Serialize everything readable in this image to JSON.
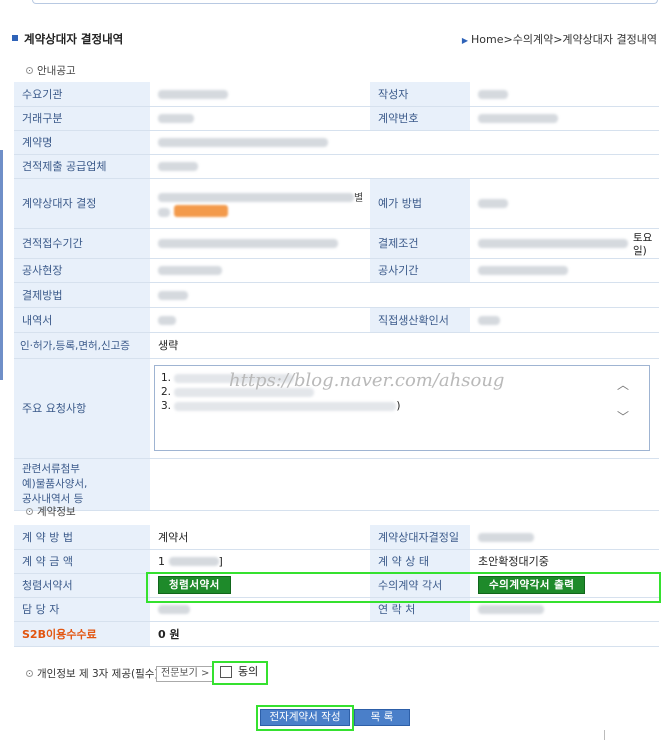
{
  "header": {
    "title": "계약상대자 결정내역",
    "breadcrumb": "Home>수의계약>계약상대자 결정내역"
  },
  "sections": {
    "notice": "안내공고",
    "contract_info": "계약정보",
    "privacy": "개인정보 제 3자 제공(필수)"
  },
  "notice_table": {
    "demand_agency": "수요기관",
    "author": "작성자",
    "trade_type": "거래구분",
    "contract_no": "계약번호",
    "contract_name": "계약명",
    "quote_supplier": "견적제출 공급업체",
    "decision": "계약상대자 결정",
    "planned_method": "예가 방법",
    "quote_period": "견적접수기간",
    "payment_terms": "결제조건",
    "payment_terms_partial": "토요일)",
    "site": "공사현장",
    "work_period": "공사기간",
    "payment_method": "결제방법",
    "details": "내역서",
    "direct_prod": "직접생산확인서",
    "license_label": "인·허가,등록,면허,신고증",
    "license_value": "생략",
    "main_request": "주요 요청사항",
    "req_1": "1.",
    "req_2": "2.",
    "req_3": "3.",
    "req_3_tail": ")",
    "watermark": "https://blog.naver.com/ahsoug",
    "attachments": "관련서류첨부\n예)물품사양서,\n공사내역서 등",
    "decision_partial": "별"
  },
  "contract_table": {
    "method_label": "계 약 방 법",
    "method_value": "계약서",
    "decision_date": "계약상대자결정일",
    "amount_label": "계 약 금 액",
    "amount_prefix": "1",
    "amount_suffix": "]",
    "status_label": "계 약 상 태",
    "status_value": "초안확정대기중",
    "pledge_label": "청렴서약서",
    "pledge_btn": "청렴서약서",
    "private_contract_label": "수의계약 각서",
    "private_contract_btn": "수의계약각서 출력",
    "manager_label": "담 당 자",
    "contact_label": "연 락 처",
    "fee_label": "S2B이용수수료",
    "fee_value": "0 원"
  },
  "privacy": {
    "full_text_btn": "전문보기 >",
    "agree_label": "동의",
    "agreed": false
  },
  "buttons": {
    "write_contract": "전자계약서 작성",
    "list": "목 록"
  },
  "colors": {
    "label_bg": "#e8f0fa",
    "label_text": "#3b5a8a",
    "green_button": "#1e8a2a",
    "blue_button": "#4a7fc9",
    "highlight": "#35e12f",
    "fee_text": "#e25510"
  }
}
